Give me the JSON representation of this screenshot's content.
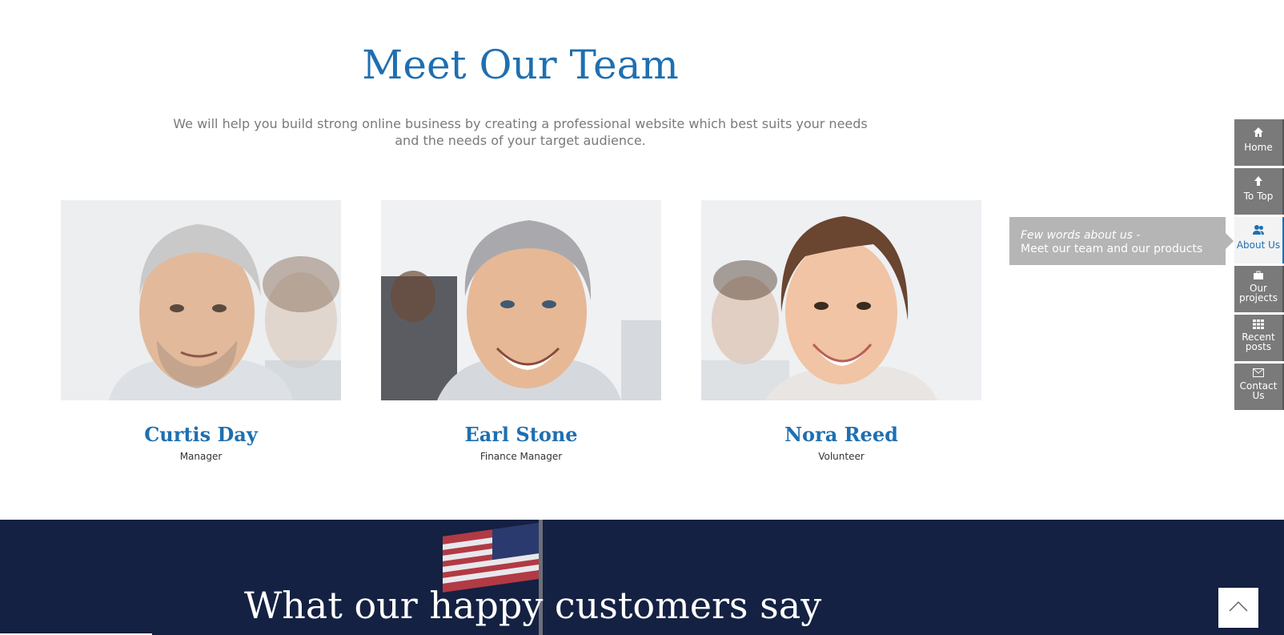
{
  "team": {
    "title": "Meet Our Team",
    "subtitle_line1": "We will help you build strong online business by creating a professional website which best suits your needs",
    "subtitle_line2": "and the needs of your target audience.",
    "members": [
      {
        "name": "Curtis Day",
        "role": "Manager"
      },
      {
        "name": "Earl Stone",
        "role": "Finance Manager"
      },
      {
        "name": "Nora Reed",
        "role": "Volunteer"
      }
    ]
  },
  "testimonials": {
    "title": "What our happy customers say"
  },
  "side_nav": {
    "items": [
      {
        "label": "Home",
        "icon": "home-icon"
      },
      {
        "label": "To Top",
        "icon": "arrow-up-icon"
      },
      {
        "label": "About Us",
        "icon": "users-icon",
        "active": true
      },
      {
        "label": "Our projects",
        "icon": "briefcase-icon"
      },
      {
        "label": "Recent posts",
        "icon": "grid-icon"
      },
      {
        "label": "Contact Us",
        "icon": "envelope-icon"
      }
    ],
    "tooltip": {
      "line1": "Few words about us -",
      "line2": "Meet our team and our products"
    }
  },
  "scroll_top": {
    "icon": "chevron-up-icon"
  },
  "colors": {
    "accent": "#1f6fb0",
    "nav_bg": "#7a7a7a",
    "tooltip_bg": "#b5b5b5",
    "dark_section": "#142142"
  }
}
